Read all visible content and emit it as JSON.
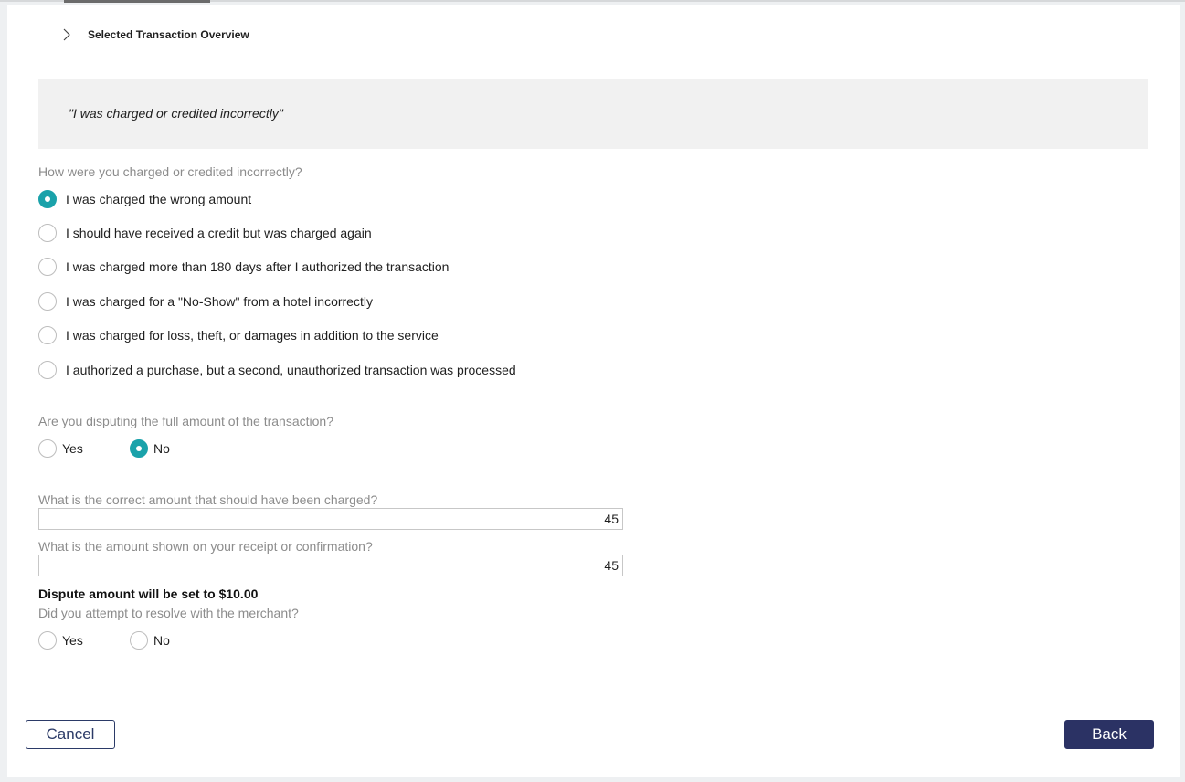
{
  "overview": {
    "title": "Selected Transaction Overview"
  },
  "quote": "\"I was charged or credited incorrectly\"",
  "q1": {
    "label": "How were you charged or credited incorrectly?",
    "options": [
      {
        "label": "I was charged the wrong amount",
        "selected": true
      },
      {
        "label": "I should have received a credit but was charged again",
        "selected": false
      },
      {
        "label": "I was charged more than 180 days after I authorized the transaction",
        "selected": false
      },
      {
        "label": "I was charged for a \"No-Show\" from a hotel incorrectly",
        "selected": false
      },
      {
        "label": "I was charged for loss, theft, or damages in addition to the service",
        "selected": false
      },
      {
        "label": "I authorized a purchase, but a second, unauthorized transaction was processed",
        "selected": false
      }
    ]
  },
  "q2": {
    "label": "Are you disputing the full amount of the transaction?",
    "yes_label": "Yes",
    "no_label": "No",
    "selected": "No"
  },
  "q3": {
    "label": "What is the correct amount that should have been charged?",
    "value": "45"
  },
  "q4": {
    "label": "What is the amount shown on your receipt or confirmation?",
    "value": "45"
  },
  "dispute_note": "Dispute amount will be set to $10.00",
  "q5": {
    "label": "Did you attempt to resolve with the merchant?",
    "yes_label": "Yes",
    "no_label": "No",
    "selected": null
  },
  "buttons": {
    "cancel": "Cancel",
    "back": "Back"
  },
  "colors": {
    "accent": "#1aa2aa",
    "primary_button": "#2b3264"
  }
}
